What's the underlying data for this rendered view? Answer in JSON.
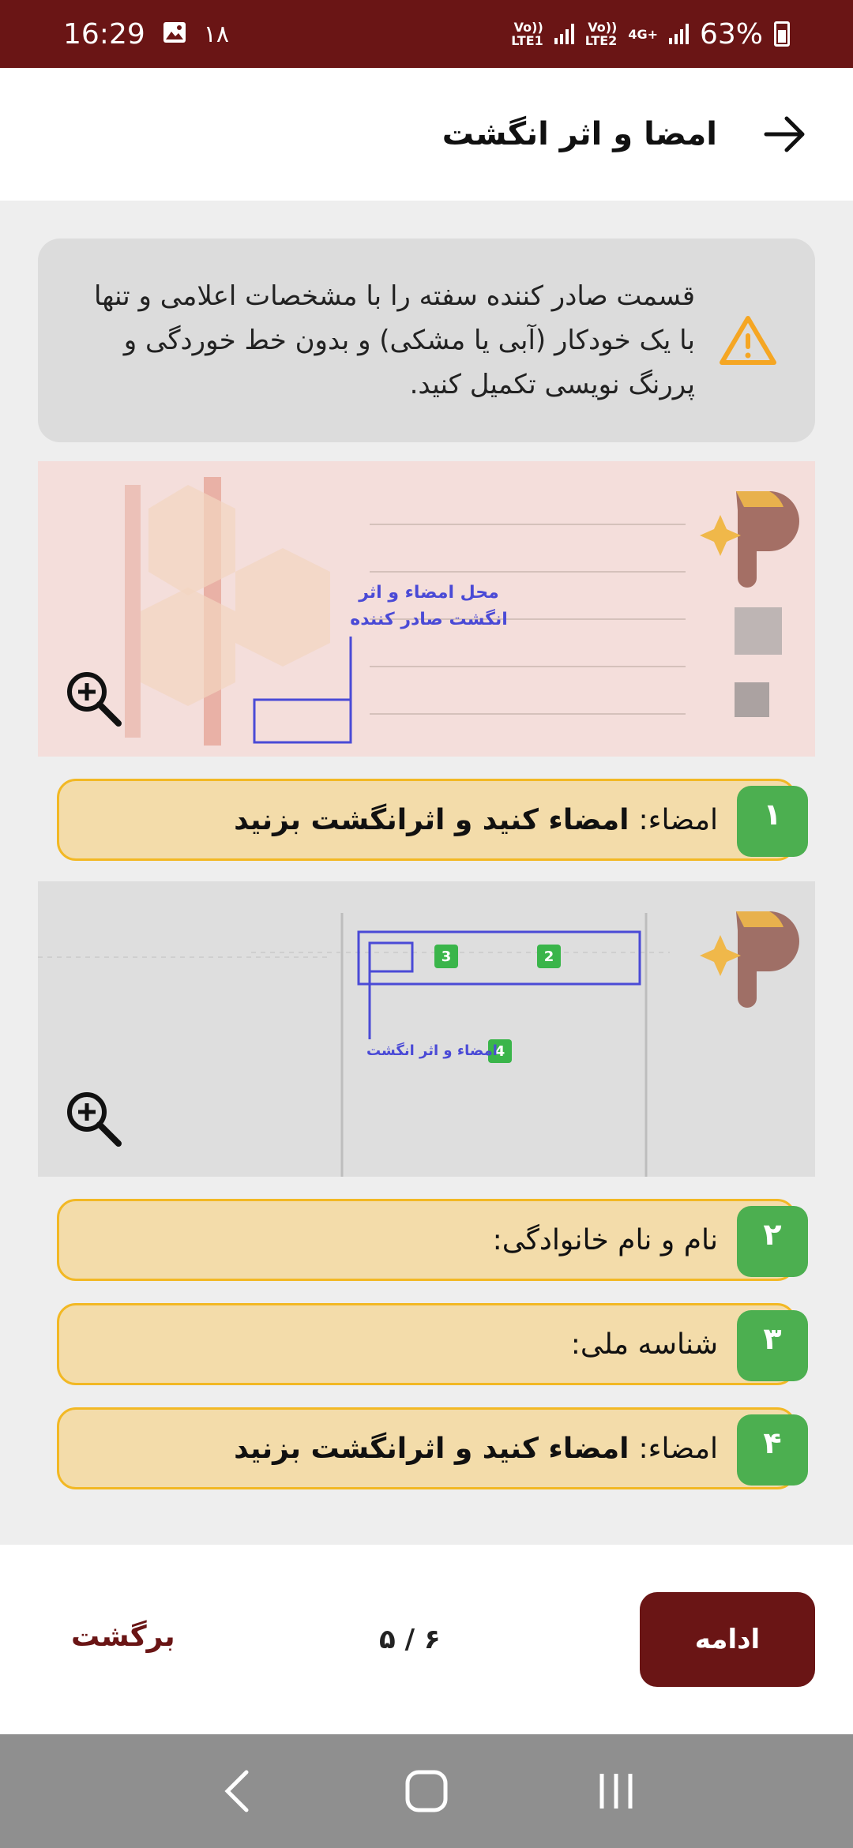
{
  "status_bar": {
    "time": "16:29",
    "notification_count": "۱۸",
    "sim1_label": "Vo))\nLTE1",
    "sim2_label": "Vo))\nLTE2",
    "network_type": "4G+",
    "battery": "63%"
  },
  "header": {
    "title": "امضا و اثر انگشت"
  },
  "warning": {
    "text": "قسمت صادر کننده سفته را با مشخصات اعلامی و تنها با یک خودکار (آبی یا مشکی) و بدون خط خوردگی و پررنگ نویسی تکمیل کنید."
  },
  "image1": {
    "annotation": "محل امضاء و اثر انگشت صادر کننده"
  },
  "image2": {
    "badges": [
      "2",
      "3",
      "4"
    ],
    "annotation": "امضاء و اثر انگشت"
  },
  "steps": [
    {
      "number": "۱",
      "label": "امضاء:",
      "value": "امضاء کنید و اثرانگشت بزنید"
    },
    {
      "number": "۲",
      "label": "نام و نام خانوادگی:",
      "value": ""
    },
    {
      "number": "۳",
      "label": "شناسه ملی:",
      "value": ""
    },
    {
      "number": "۴",
      "label": "امضاء:",
      "value": "امضاء کنید و اثرانگشت بزنید"
    }
  ],
  "bottom": {
    "continue_label": "ادامه",
    "pager": "۶ / ۵",
    "back_label": "برگشت"
  },
  "colors": {
    "primary": "#6a1515",
    "step_bg": "#f3dcaa",
    "step_border": "#f2b824",
    "badge": "#4caf50",
    "warning_icon": "#f5a623"
  }
}
